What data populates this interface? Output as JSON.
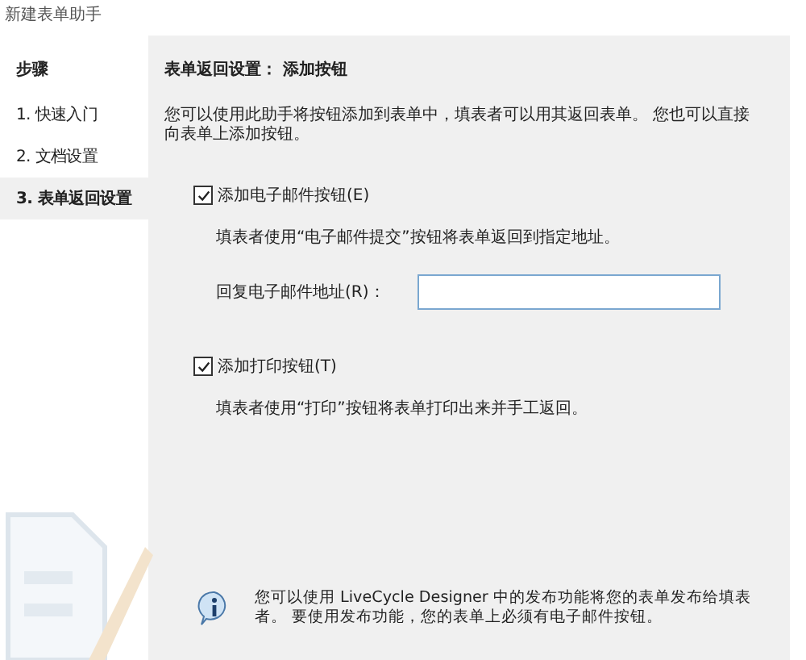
{
  "window": {
    "title": "新建表单助手"
  },
  "sidebar": {
    "heading": "步骤",
    "items": [
      {
        "label": "1. 快速入门",
        "selected": false
      },
      {
        "label": "2. 文档设置",
        "selected": false
      },
      {
        "label": "3. 表单返回设置",
        "selected": true
      }
    ]
  },
  "content": {
    "heading": "表单返回设置： 添加按钮",
    "intro": "您可以使用此助手将按钮添加到表单中，填表者可以用其返回表单。 您也可以直接向表单上添加按钮。",
    "options": [
      {
        "label": "添加电子邮件按钮(E)",
        "checked": true,
        "description": "填表者使用“电子邮件提交”按钮将表单返回到指定地址。",
        "field": {
          "label": "回复电子邮件地址(R)："
        }
      },
      {
        "label": "添加打印按钮(T)",
        "checked": true,
        "description": "填表者使用“打印”按钮将表单打印出来并手工返回。"
      }
    ],
    "info": "您可以使用 LiveCycle Designer 中的发布功能将您的表单发布给填表者。 要使用发布功能，您的表单上必须有电子邮件按钮。"
  }
}
